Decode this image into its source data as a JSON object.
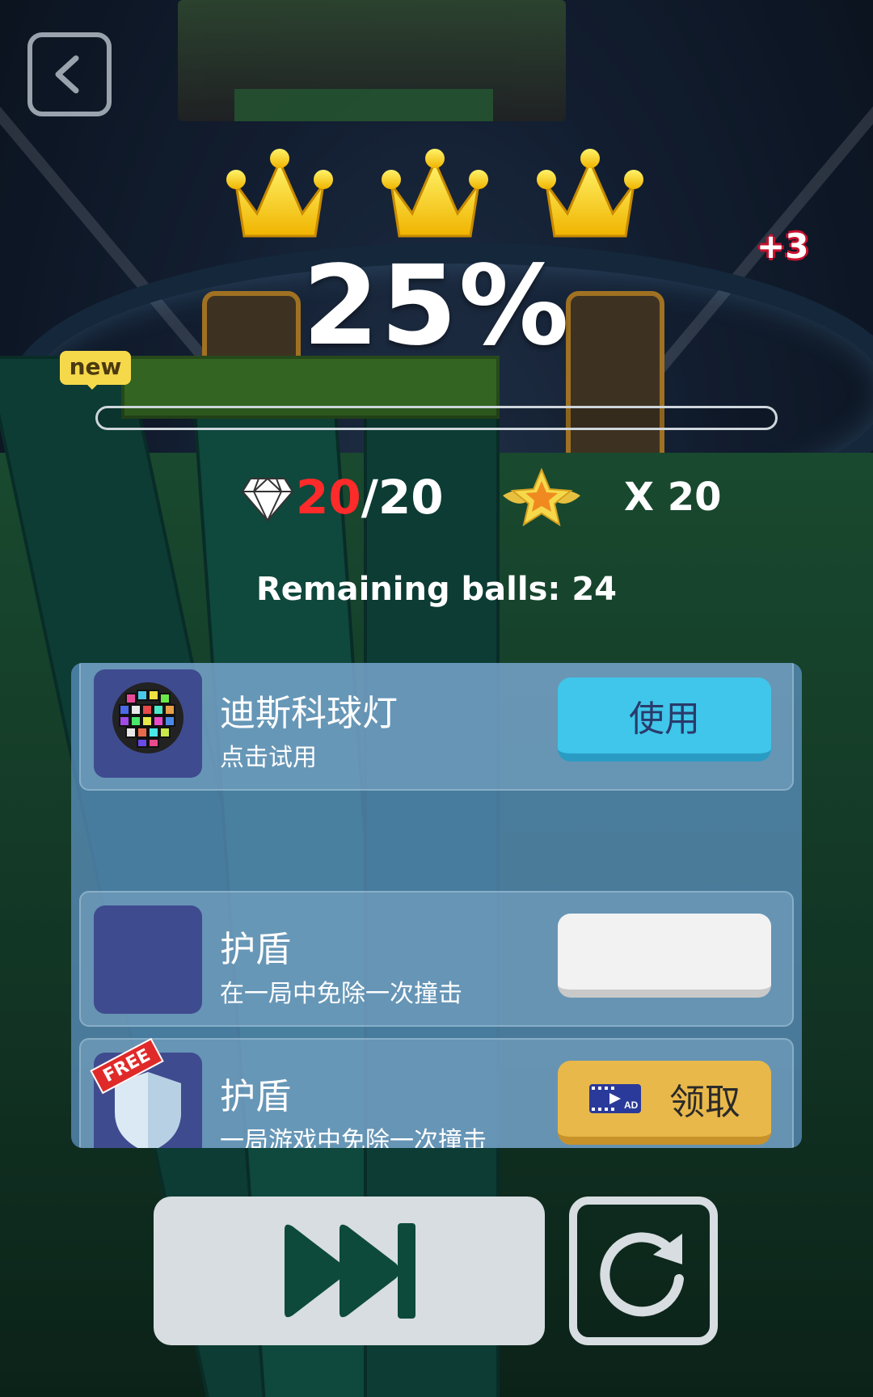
{
  "header": {
    "back_icon": "back-arrow-icon"
  },
  "result": {
    "crowns": 3,
    "crown_icon": "crown-icon",
    "bonus_text": "+3",
    "percent_text": "25%",
    "progress_fraction": 0.0,
    "new_badge": "new"
  },
  "stats": {
    "gem_icon": "diamond-icon",
    "gems_current": "20",
    "gems_total": "/20",
    "star_icon": "winged-star-icon",
    "star_multiplier": "X 20",
    "remaining_balls": "Remaining balls: 24"
  },
  "shop_items": [
    {
      "name": "迪斯科球灯",
      "desc": "点击试用",
      "button": "使用",
      "button_style": "blue",
      "icon": "disco-ball-icon"
    },
    {
      "name": "护盾",
      "desc": "在一局中免除一次撞击",
      "button": "",
      "button_style": "white",
      "icon": ""
    },
    {
      "name": "护盾",
      "desc": "一局游戏中免除一次撞击",
      "button": "领取",
      "button_style": "gold",
      "icon": "shield-icon",
      "tag": "FREE",
      "ad_icon": "ad-video-icon"
    }
  ],
  "controls": {
    "next_icon": "fast-forward-icon",
    "restart_icon": "restart-icon"
  },
  "colors": {
    "gem_current": "#ff2a2a",
    "use_button": "#3fc6ea",
    "claim_button": "#e8b84a",
    "panel": "#6096c8"
  }
}
